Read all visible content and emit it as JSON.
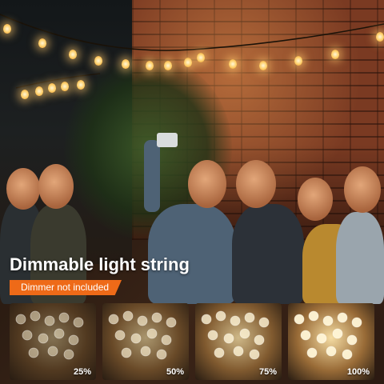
{
  "title": "Dimmable light string",
  "badge": "Dimmer not included",
  "brightness_panels": [
    {
      "label": "25%",
      "level": 0.25
    },
    {
      "label": "50%",
      "level": 0.5
    },
    {
      "label": "75%",
      "level": 0.75
    },
    {
      "label": "100%",
      "level": 1.0
    }
  ],
  "colors": {
    "accent": "#ee6a18",
    "text": "#ffffff",
    "bulb_glow": "#ffcf6a"
  }
}
